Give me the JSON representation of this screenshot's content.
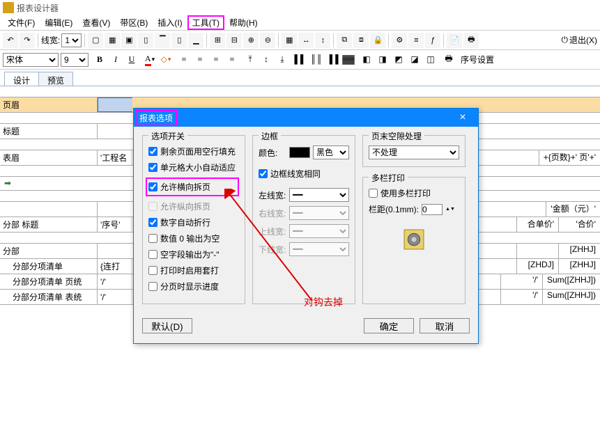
{
  "app_title": "报表设计器",
  "menu": {
    "file": "文件(F)",
    "edit": "编辑(E)",
    "view": "查看(V)",
    "band": "带区(B)",
    "insert": "插入(I)",
    "tool": "工具(T)",
    "help": "帮助(H)"
  },
  "toolbar": {
    "line_width_label": "线宽:",
    "line_width_value": "1",
    "exit_label": "退出(X)"
  },
  "fmt": {
    "font": "宋体",
    "size": "9",
    "serial_label": "序号设置"
  },
  "tabs": {
    "design": "设计",
    "preview": "预览"
  },
  "bands": {
    "page_header": "页眉",
    "title": "标题",
    "table_header": "表眉",
    "section_title": "分部 标题",
    "section": "分部",
    "detail_list": "分部分项清单",
    "detail_sum": "分部分项清单 页统",
    "detail_total": "分部分项清单 表统"
  },
  "cells": {
    "th_engineering": "'工程名",
    "th_serial": "'序号'",
    "th_brace": "{连打",
    "th_slash1": "'/'",
    "th_slash2": "'/'",
    "right_pages": "+{页数}+' 页'+'",
    "right_amount": "'金额（元）'",
    "right_unitprice": "合单价'",
    "right_total": "'合价'",
    "right_zhhj": "[ZHHJ]",
    "right_zhdj": "[ZHDJ]",
    "right_sumzhhj": "Sum([ZHHJ])"
  },
  "dialog": {
    "title": "报表选项",
    "fs_opts": "选项开关",
    "opt_fill_blank": "剩余页面用空行填充",
    "opt_auto_fit": "单元格大小自动适应",
    "opt_h_break": "允许横向拆页",
    "opt_v_break": "允许纵向拆页",
    "opt_num_wrap": "数字自动折行",
    "opt_zero_blank": "数值 0 输出为空",
    "opt_empty_dash": "空字段输出为\"-\"",
    "opt_print_overlay": "打印时启用套打",
    "opt_page_progress": "分页时显示进度",
    "fs_border": "边框",
    "color_label": "颜色:",
    "color_value": "黑色",
    "border_same": "边框线宽相同",
    "left_w": "左线宽:",
    "right_w": "右线宽:",
    "top_w": "上线宽:",
    "bottom_w": "下线宽:",
    "fs_gap": "页末空隙处理",
    "gap_value": "不处理",
    "fs_cols": "多栏打印",
    "use_cols": "使用多栏打印",
    "col_gap_label": "栏距(0.1mm):",
    "col_gap_value": "0",
    "btn_default": "默认(D)",
    "btn_ok": "确定",
    "btn_cancel": "取消"
  },
  "annotation": "对钩去掉"
}
